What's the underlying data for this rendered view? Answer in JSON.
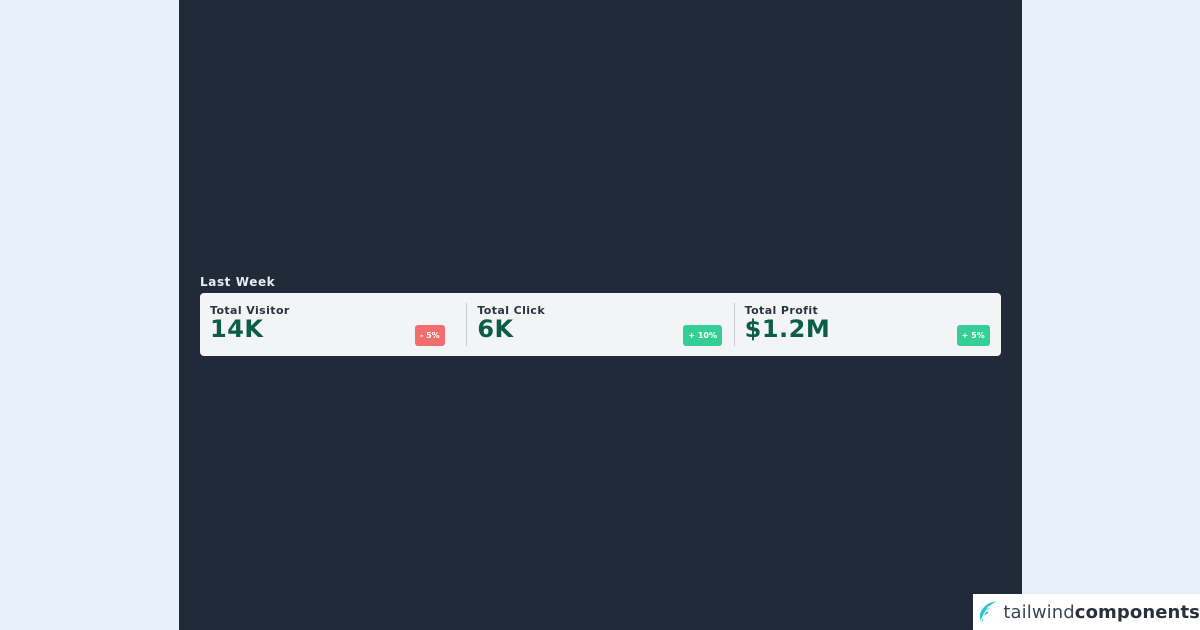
{
  "section": {
    "title": "Last Week"
  },
  "stats": [
    {
      "label": "Total Visitor",
      "value": "14K",
      "change": "- 5%",
      "trend": "down"
    },
    {
      "label": "Total Click",
      "value": "6K",
      "change": "+ 10%",
      "trend": "up"
    },
    {
      "label": "Total Profit",
      "value": "$1.2M",
      "change": "+ 5%",
      "trend": "up"
    }
  ],
  "brand": {
    "light": "tailwind",
    "bold": "components"
  },
  "colors": {
    "frame_bg": "#212a38",
    "card_bg": "#f3f4f6",
    "value_text": "#0b5e45",
    "badge_down": "#f26d6d",
    "badge_up": "#33cf96"
  }
}
